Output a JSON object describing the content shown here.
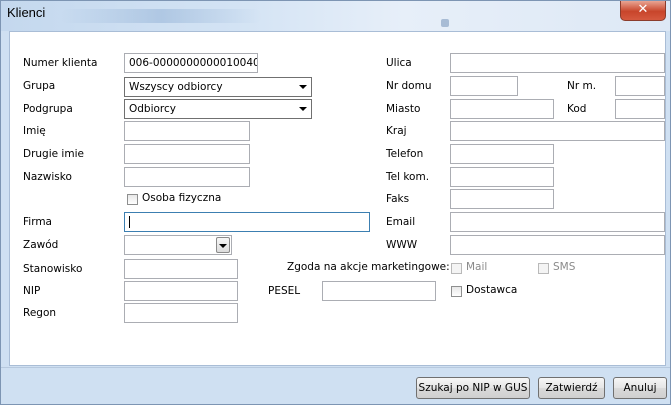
{
  "window": {
    "title": "Klienci",
    "close_label": "✕"
  },
  "form": {
    "numer_klienta": {
      "label": "Numer klienta",
      "value": "006-0000000000010040"
    },
    "grupa": {
      "label": "Grupa",
      "value": "Wszyscy odbiorcy"
    },
    "podgrupa": {
      "label": "Podgrupa",
      "value": "Odbiorcy"
    },
    "imie": {
      "label": "Imię",
      "value": ""
    },
    "drugie_imie": {
      "label": "Drugie imie",
      "value": ""
    },
    "nazwisko": {
      "label": "Nazwisko",
      "value": ""
    },
    "osoba_fizyczna": {
      "label": "Osoba fizyczna",
      "checked": false
    },
    "firma": {
      "label": "Firma",
      "value": ""
    },
    "zawod": {
      "label": "Zawód",
      "value": ""
    },
    "stanowisko": {
      "label": "Stanowisko",
      "value": ""
    },
    "nip": {
      "label": "NIP",
      "value": ""
    },
    "regon": {
      "label": "Regon",
      "value": ""
    },
    "pesel": {
      "label": "PESEL",
      "value": ""
    },
    "dostawca": {
      "label": "Dostawca",
      "checked": false
    },
    "ulica": {
      "label": "Ulica",
      "value": ""
    },
    "nr_domu": {
      "label": "Nr domu",
      "value": ""
    },
    "nr_m": {
      "label": "Nr m.",
      "value": ""
    },
    "miasto": {
      "label": "Miasto",
      "value": ""
    },
    "kod": {
      "label": "Kod",
      "value": ""
    },
    "kraj": {
      "label": "Kraj",
      "value": ""
    },
    "telefon": {
      "label": "Telefon",
      "value": ""
    },
    "tel_kom": {
      "label": "Tel kom.",
      "value": ""
    },
    "faks": {
      "label": "Faks",
      "value": ""
    },
    "email": {
      "label": "Email",
      "value": ""
    },
    "www": {
      "label": "WWW",
      "value": ""
    },
    "zgoda": {
      "label": "Zgoda na akcje marketingowe:",
      "mail_label": "Mail",
      "sms_label": "SMS"
    }
  },
  "buttons": {
    "szukaj": "Szukaj po NIP w GUS",
    "zatwierdz": "Zatwierdź",
    "anuluj": "Anuluj"
  }
}
